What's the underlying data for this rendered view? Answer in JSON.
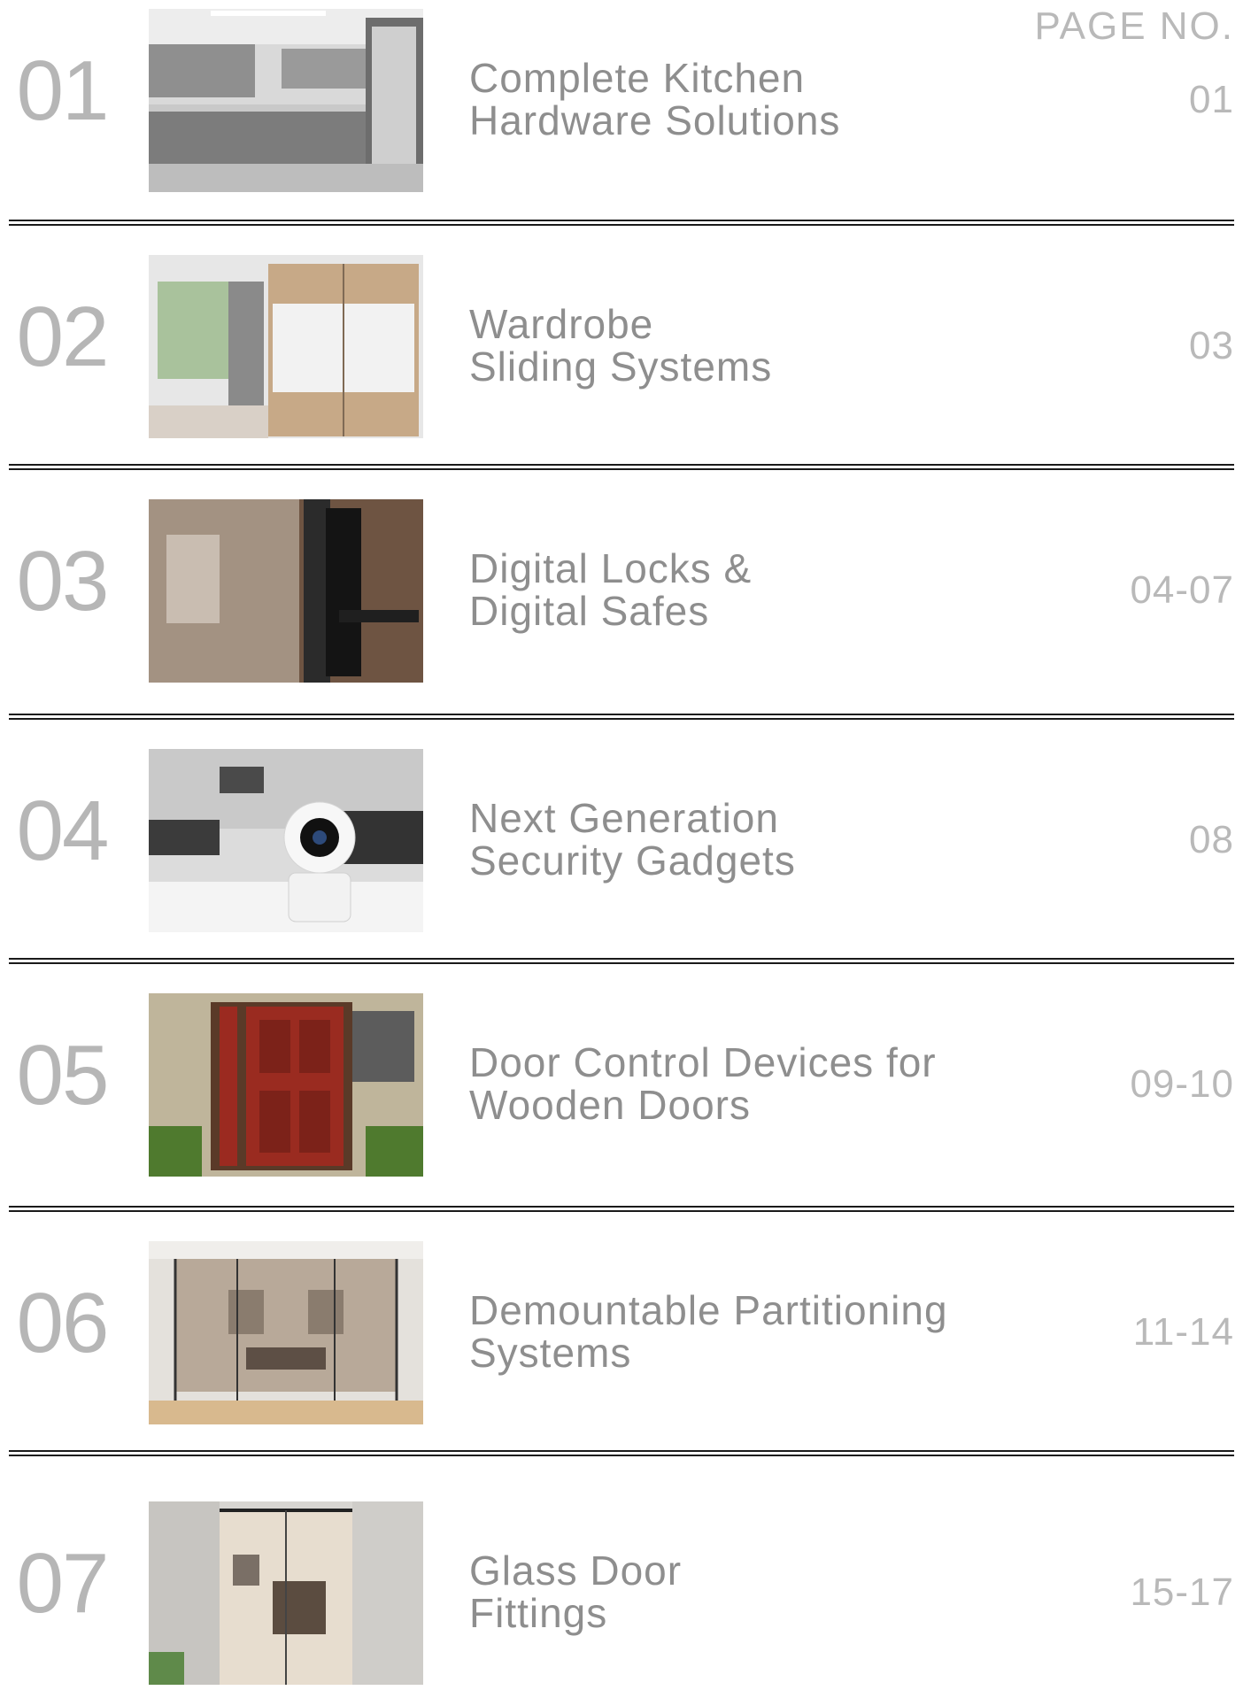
{
  "header": {
    "page_no_label": "PAGE NO."
  },
  "rows": [
    {
      "num": "01",
      "title_line1": "Complete Kitchen",
      "title_line2": "Hardware Solutions",
      "page": "01",
      "image": "kitchen-photo"
    },
    {
      "num": "02",
      "title_line1": "Wardrobe",
      "title_line2": "Sliding Systems",
      "page": "03",
      "image": "wardrobe-photo"
    },
    {
      "num": "03",
      "title_line1": "Digital Locks &",
      "title_line2": "Digital Safes",
      "page": "04-07",
      "image": "digital-lock-photo"
    },
    {
      "num": "04",
      "title_line1": "Next Generation",
      "title_line2": "Security Gadgets",
      "page": "08",
      "image": "security-camera-photo"
    },
    {
      "num": "05",
      "title_line1": "Door Control Devices for",
      "title_line2": "Wooden Doors",
      "page": "09-10",
      "image": "wooden-door-photo"
    },
    {
      "num": "06",
      "title_line1": "Demountable Partitioning",
      "title_line2": "Systems",
      "page": "11-14",
      "image": "glass-partition-photo"
    },
    {
      "num": "07",
      "title_line1": "Glass Door",
      "title_line2": "Fittings",
      "page": "15-17",
      "image": "glass-door-photo"
    }
  ],
  "colors": {
    "number_gray": "#b6b6b6",
    "title_gray": "#8e8e8e",
    "rule": "#1a1a1a"
  }
}
